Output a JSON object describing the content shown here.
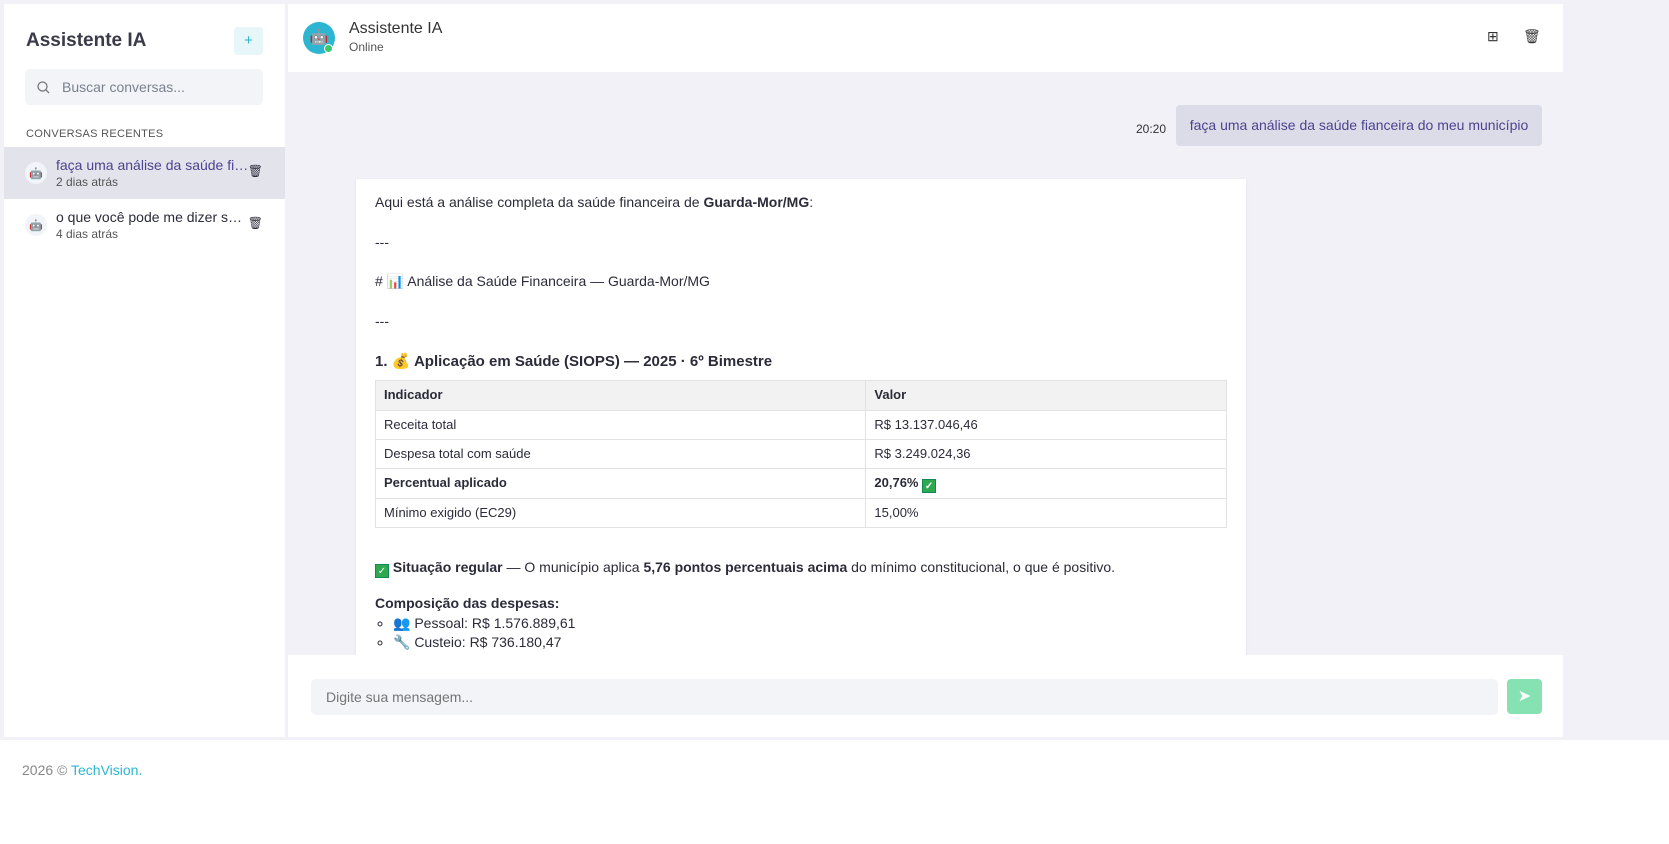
{
  "sidebar": {
    "title": "Assistente IA",
    "new_label": "+",
    "search_placeholder": "Buscar conversas...",
    "section": "CONVERSAS RECENTES",
    "conversations": [
      {
        "title": "faça uma análise da saúde fianceira do meu município",
        "time": "2 dias atrás"
      },
      {
        "title": "o que você pode me dizer sobre",
        "time": "4 dias atrás"
      }
    ]
  },
  "header": {
    "title": "Assistente IA",
    "status": "Online"
  },
  "messages": {
    "user": {
      "time": "20:20",
      "text": "faça uma análise da saúde fianceira do meu município"
    },
    "bot": {
      "intro": "Aqui está a análise completa da saúde financeira de ",
      "city": "Guarda-Mor/MG",
      "sep": "---",
      "heading": "# 📊 Análise da Saúde Financeira — Guarda-Mor/MG",
      "section1": "1. 💰 Aplicação em Saúde (SIOPS) — 2025 · 6º Bimestre",
      "table": {
        "headers": [
          "Indicador",
          "Valor"
        ],
        "rows": [
          [
            "Receita total",
            "R$ 13.137.046,46"
          ],
          [
            "Despesa total com saúde",
            "R$ 3.249.024,36"
          ],
          [
            "Percentual aplicado",
            "20,76%"
          ],
          [
            "Mínimo exigido (EC29)",
            "15,00%"
          ]
        ]
      },
      "status_bold": "Situação regular",
      "status_mid": " — O município aplica ",
      "status_bold2": "5,76 pontos percentuais acima",
      "status_end": " do mínimo constitucional, o que é positivo.",
      "comp_title": "Composição das despesas:",
      "comp": [
        "👥 Pessoal: R$ 1.576.889,61",
        "🔧 Custeio: R$ 736.180,47"
      ]
    }
  },
  "input": {
    "placeholder": "Digite sua mensagem..."
  },
  "footer": {
    "text": "2026 © ",
    "brand": "TechVision."
  }
}
